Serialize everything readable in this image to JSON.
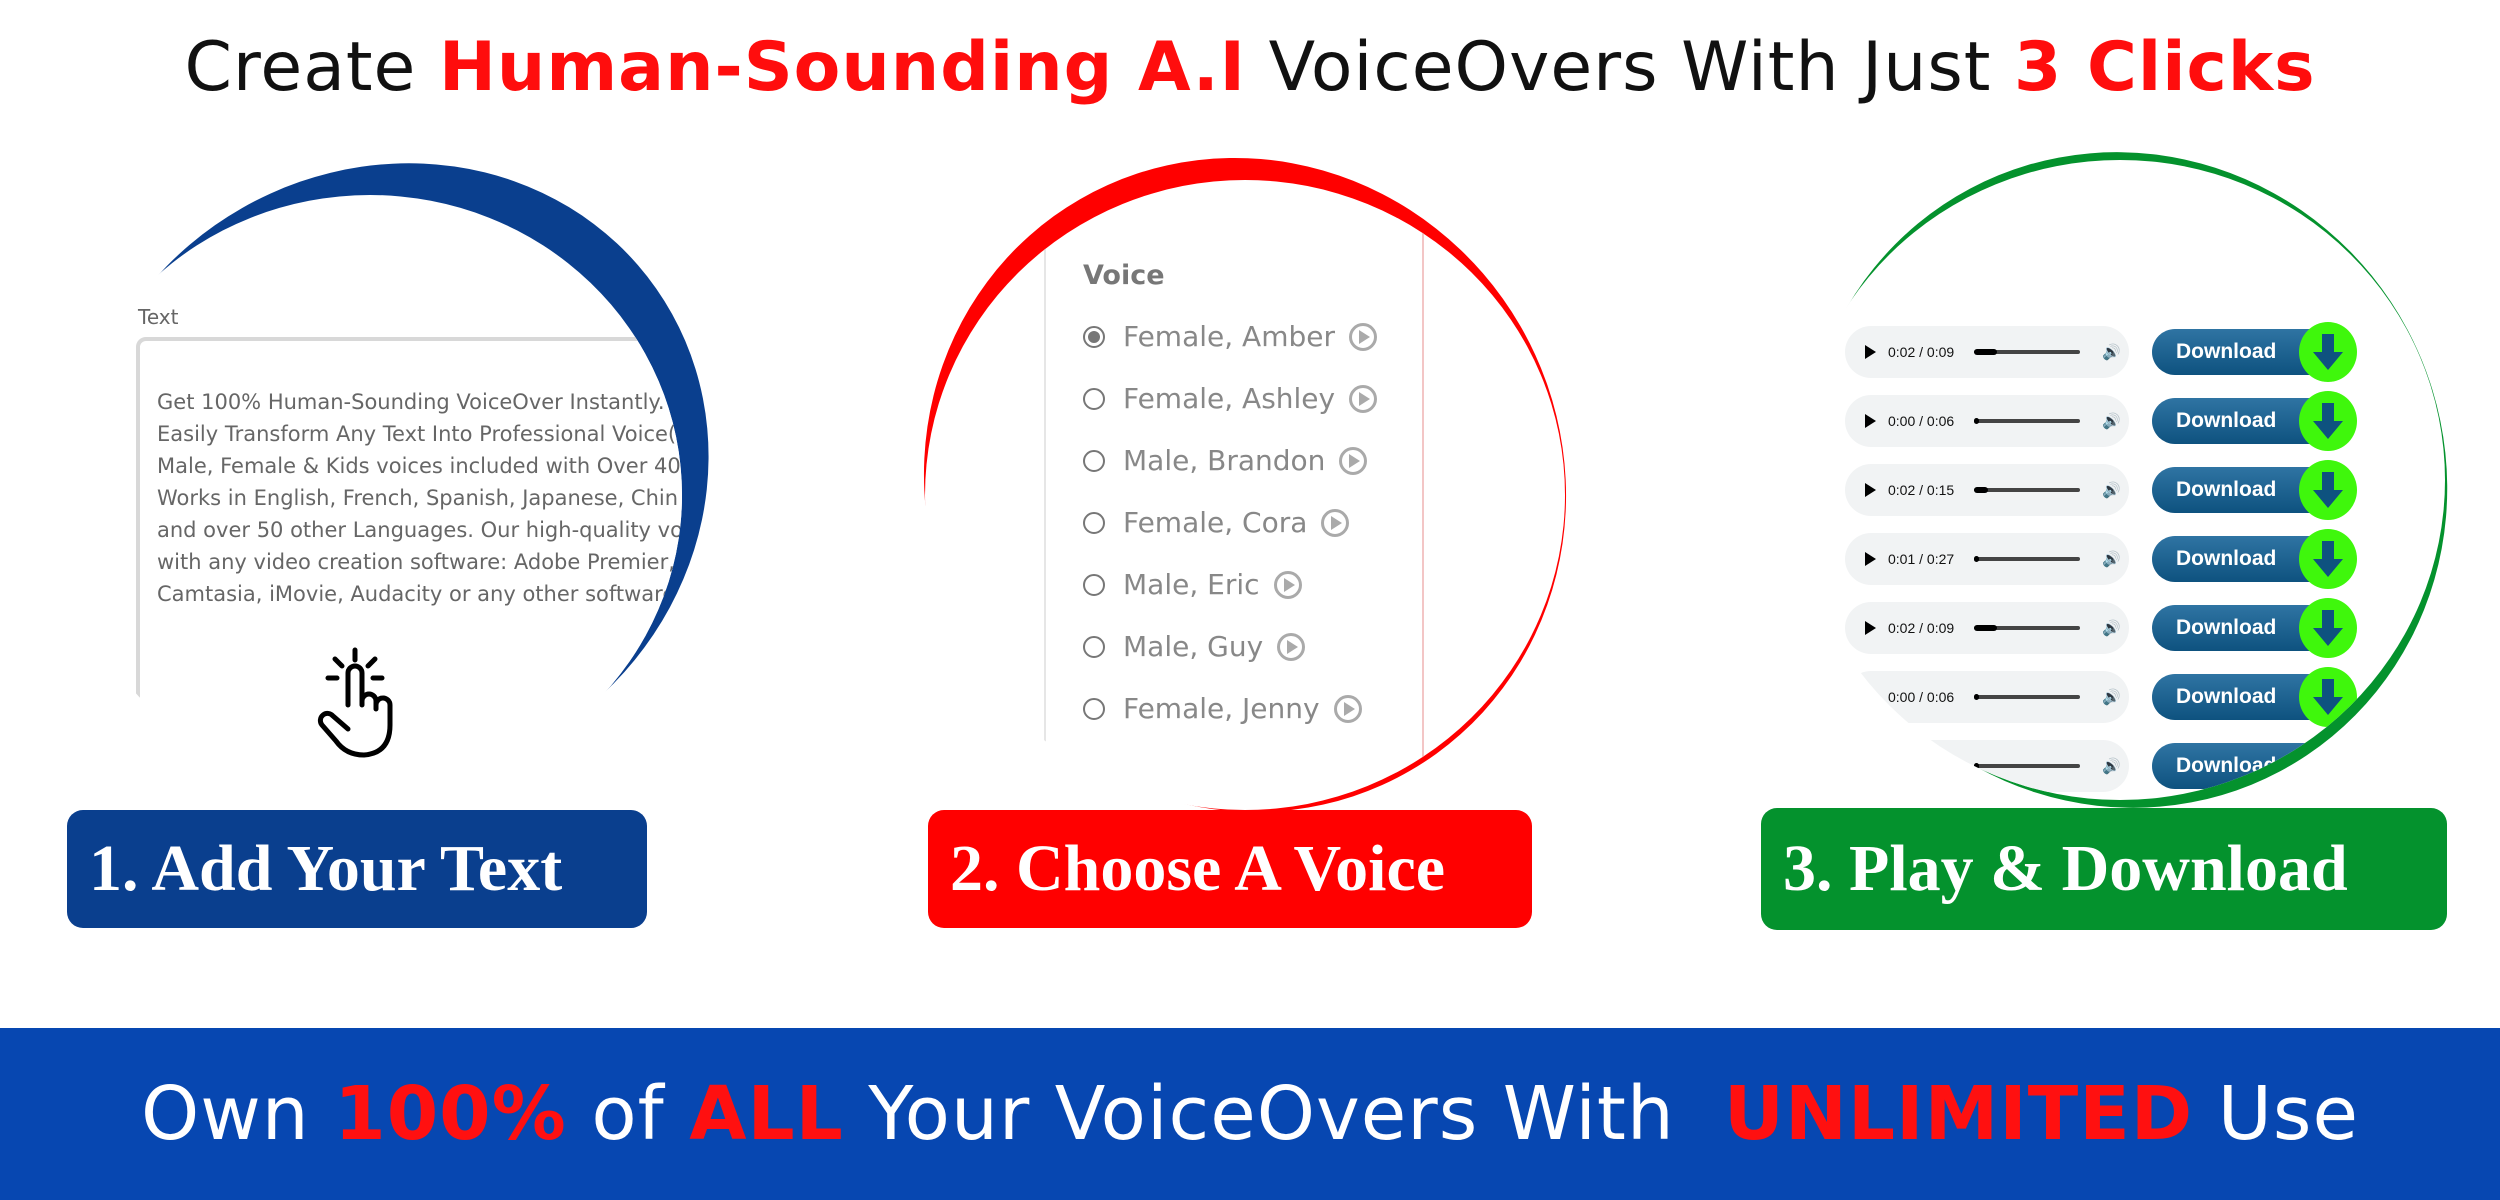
{
  "headline": {
    "part1": "Create ",
    "highlight1": "Human-Sounding A.I",
    "part2": " VoiceOvers With Just ",
    "highlight2": "3 Clicks"
  },
  "colors": {
    "red": "#ff0d0d",
    "blue": "#0a3f8e",
    "green": "#04922d",
    "band": "#0747b1",
    "download_icon": "#3ff70c"
  },
  "step1": {
    "label": "1. Add Your Text",
    "field_label": "Text",
    "lines": [
      "Get 100% Human-Sounding VoiceOver Instantly.",
      "Easily Transform Any Text Into Professional Voice(",
      "Male, Female & Kids voices included with Over 40",
      "Works in English, French, Spanish, Japanese, Chin",
      "and over 50 other Languages. Our high-quality vo",
      "with any video creation software: Adobe Premier,",
      "Camtasia, iMovie, Audacity or any other software"
    ],
    "icon": "hand-pointer-click-icon"
  },
  "step2": {
    "label": "2. Choose A Voice",
    "field_label": "Voice",
    "voices": [
      {
        "name": "Female, Amber",
        "selected": true
      },
      {
        "name": "Female, Ashley",
        "selected": false
      },
      {
        "name": "Male, Brandon",
        "selected": false
      },
      {
        "name": "Female, Cora",
        "selected": false
      },
      {
        "name": "Male, Eric",
        "selected": false
      },
      {
        "name": "Male, Guy",
        "selected": false
      },
      {
        "name": "Female, Jenny",
        "selected": false
      }
    ]
  },
  "step3": {
    "label": "3. Play & Download",
    "download_label": "Download",
    "players": [
      {
        "time": "0:02 / 0:09",
        "progress": 0.22
      },
      {
        "time": "0:00 / 0:06",
        "progress": 0.05
      },
      {
        "time": "0:02 / 0:15",
        "progress": 0.13
      },
      {
        "time": "0:01 / 0:27",
        "progress": 0.05
      },
      {
        "time": "0:02 / 0:09",
        "progress": 0.22
      },
      {
        "time": "0:00 / 0:06",
        "progress": 0.05
      },
      {
        "time": "",
        "progress": 0.05
      }
    ]
  },
  "band": {
    "p1": "Own ",
    "h1": "100%",
    "p2": " of ",
    "h2": "ALL",
    "p3": " Your VoiceOvers With  ",
    "h3": "UNLIMITED",
    "p4": " Use"
  }
}
